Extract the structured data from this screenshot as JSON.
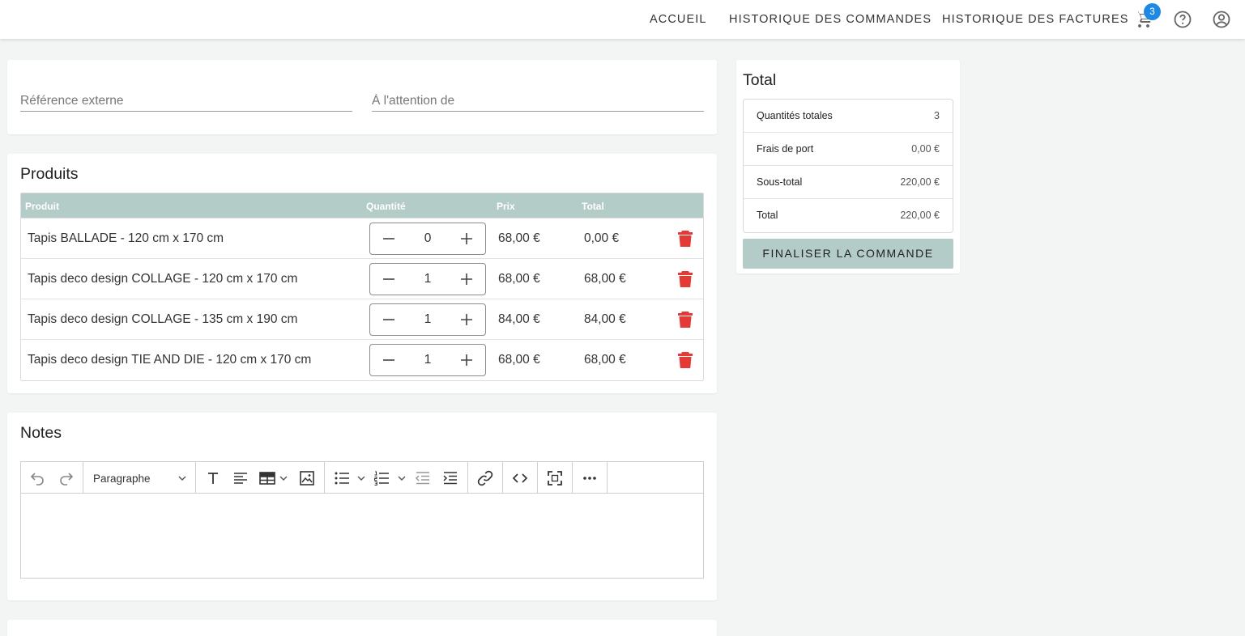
{
  "nav": {
    "home": "ACCUEIL",
    "orders_history": "HISTORIQUE DES COMMANDES",
    "invoices_history": "HISTORIQUE DES FACTURES",
    "cart_count": "3",
    "icons": [
      "cart-icon",
      "help-icon",
      "account-icon"
    ]
  },
  "reference": {
    "external_placeholder": "Référence externe",
    "attention_placeholder": "À l'attention de"
  },
  "products": {
    "title": "Produits",
    "headers": {
      "product": "Produit",
      "quantity": "Quantité",
      "price": "Prix",
      "total": "Total"
    },
    "rows": [
      {
        "name": "Tapis BALLADE - 120 cm x 170 cm",
        "quantity": "0",
        "price": "68,00 €",
        "total": "0,00 €"
      },
      {
        "name": "Tapis deco design COLLAGE - 120 cm x 170 cm",
        "quantity": "1",
        "price": "68,00 €",
        "total": "68,00 €"
      },
      {
        "name": "Tapis deco design COLLAGE - 135 cm x 190 cm",
        "quantity": "1",
        "price": "84,00 €",
        "total": "84,00 €"
      },
      {
        "name": "Tapis deco design TIE AND DIE - 120 cm x 170 cm",
        "quantity": "1",
        "price": "68,00 €",
        "total": "68,00 €"
      }
    ]
  },
  "notes": {
    "title": "Notes",
    "paragraph_format": "Paragraphe",
    "content": ""
  },
  "summary": {
    "title": "Total",
    "rows": [
      {
        "label": "Quantités totales",
        "value": "3"
      },
      {
        "label": "Frais de port",
        "value": "0,00 €"
      },
      {
        "label": "Sous-total",
        "value": "220,00 €"
      },
      {
        "label": "Total",
        "value": "220,00 €"
      }
    ],
    "finalize_label": "FINALISER LA COMMANDE"
  },
  "colors": {
    "accent": "#b3ccc7",
    "badge": "#1e88e5",
    "delete": "#e53935",
    "background": "#f3f5f4"
  }
}
